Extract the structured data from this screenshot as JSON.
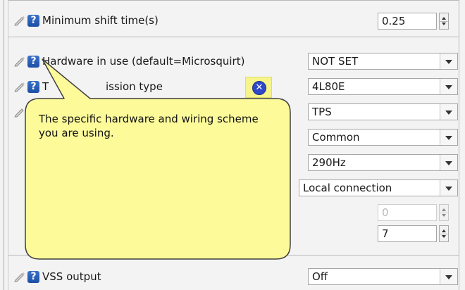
{
  "settings": {
    "min_shift_time": {
      "label": "Minimum shift time(s)",
      "value": "0.25"
    },
    "hardware_in_use": {
      "label": "Hardware in use (default=Microsquirt)",
      "value": "NOT SET"
    },
    "transmission_type": {
      "label_visible": "T",
      "label_visible_tail": "ission type",
      "value": "4L80E"
    },
    "row3": {
      "value": "TPS"
    },
    "row4": {
      "value": "Common"
    },
    "row5": {
      "value": "290Hz"
    },
    "row6": {
      "value": "Local connection"
    },
    "row7": {
      "value": "0"
    },
    "row8": {
      "value": "7"
    },
    "vss_output": {
      "label": "VSS output",
      "value": "Off"
    }
  },
  "tooltip": {
    "text": "The specific hardware and wiring scheme you are using."
  },
  "icons": {
    "pencil": "pencil-icon",
    "help": "help-icon",
    "close": "close-icon",
    "dropdown": "chevron-down-icon",
    "spin_up": "spin-up-icon",
    "spin_down": "spin-down-icon"
  },
  "colors": {
    "tooltip_bg": "#fdfa9a",
    "tooltip_border": "#3f3f3f",
    "help_icon": "#2a5fb8",
    "close_icon": "#2f47c9"
  }
}
